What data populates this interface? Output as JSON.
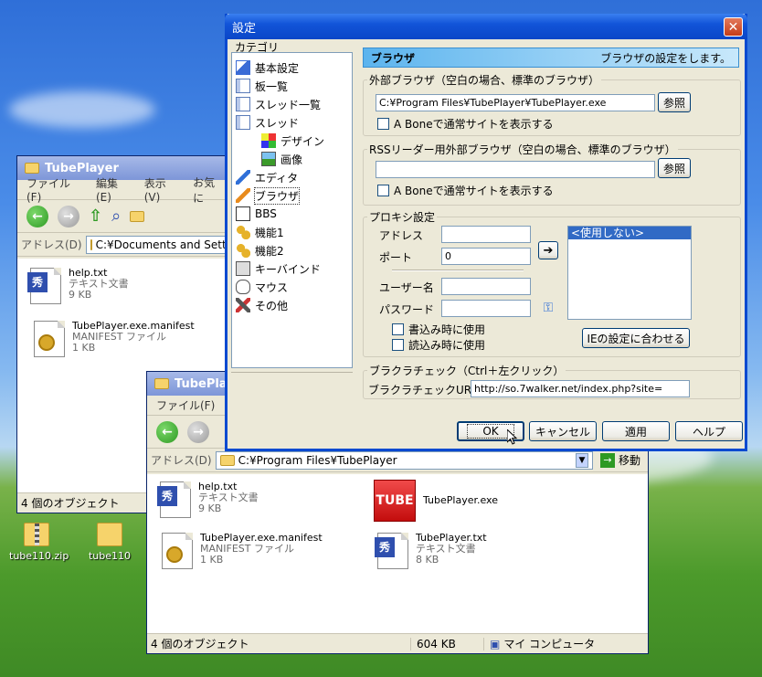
{
  "colors": {
    "xp_blue": "#0a4ad0",
    "selection": "#316ac5",
    "accent_header": "#5cb4ee"
  },
  "explorer_back": {
    "title": "TubePlayer",
    "menu": [
      "ファイル(F)",
      "編集(E)",
      "表示(V)",
      "お気に"
    ],
    "address_label": "アドレス(D)",
    "address": "C:¥Documents and Settin",
    "files": [
      {
        "name": "help.txt",
        "type": "テキスト文書",
        "size": "9 KB",
        "icon": "text-doc-icon"
      },
      {
        "name": "TubePlayer.exe.manifest",
        "type": "MANIFEST ファイル",
        "size": "1 KB",
        "icon": "manifest-icon"
      }
    ],
    "status": "4 個のオブジェクト"
  },
  "explorer_front": {
    "title": "TubePla",
    "menu": [
      "ファイル(F)"
    ],
    "address_label": "アドレス(D)",
    "address": "C:¥Program Files¥TubePlayer",
    "go_label": "移動",
    "files": [
      {
        "name": "help.txt",
        "type": "テキスト文書",
        "size": "9 KB",
        "icon": "text-doc-icon"
      },
      {
        "name": "TubePlayer.exe",
        "type": "",
        "size": "",
        "icon": "tube-exe-icon",
        "icon_text": "TUBE"
      },
      {
        "name": "TubePlayer.exe.manifest",
        "type": "MANIFEST ファイル",
        "size": "1 KB",
        "icon": "manifest-icon"
      },
      {
        "name": "TubePlayer.txt",
        "type": "テキスト文書",
        "size": "8 KB",
        "icon": "text-doc-icon"
      }
    ],
    "status": "4 個のオブジェクト",
    "status_size": "604 KB",
    "status_location": "マイ コンピュータ"
  },
  "desktop": {
    "icons": [
      {
        "label": "tube110.zip",
        "icon": "zip-folder-icon"
      },
      {
        "label": "tube110",
        "icon": "folder-icon"
      }
    ]
  },
  "dialog": {
    "title": "設定",
    "category_label": "カテゴリ",
    "tree": [
      {
        "label": "基本設定",
        "icon": "chart-icon",
        "indent": 0
      },
      {
        "label": "板一覧",
        "icon": "window-icon",
        "indent": 0
      },
      {
        "label": "スレッド一覧",
        "icon": "window-icon",
        "indent": 0
      },
      {
        "label": "スレッド",
        "icon": "window-icon",
        "indent": 0
      },
      {
        "label": "デザイン",
        "icon": "palette-icon",
        "indent": 1
      },
      {
        "label": "画像",
        "icon": "image-icon",
        "indent": 1
      },
      {
        "label": "エディタ",
        "icon": "pencil-icon",
        "indent": 0
      },
      {
        "label": "ブラウザ",
        "icon": "pen-icon",
        "indent": 0,
        "selected": true
      },
      {
        "label": "BBS",
        "icon": "board-icon",
        "indent": 0
      },
      {
        "label": "機能1",
        "icon": "gears-icon",
        "indent": 0
      },
      {
        "label": "機能2",
        "icon": "gears-icon",
        "indent": 0
      },
      {
        "label": "キーバインド",
        "icon": "key-icon",
        "indent": 0
      },
      {
        "label": "マウス",
        "icon": "mouse-icon",
        "indent": 0
      },
      {
        "label": "その他",
        "icon": "tools-icon",
        "indent": 0
      }
    ],
    "panel_title": "ブラウザ",
    "panel_desc": "ブラウザの設定をします。",
    "external_browser": {
      "legend": "外部ブラウザ（空白の場合、標準のブラウザ）",
      "path": "C:¥Program Files¥TubePlayer¥TubePlayer.exe",
      "browse": "参照",
      "checkbox": "A Boneで通常サイトを表示する"
    },
    "rss_browser": {
      "legend": "RSSリーダー用外部ブラウザ（空白の場合、標準のブラウザ）",
      "path": "",
      "browse": "参照",
      "checkbox": "A Boneで通常サイトを表示する"
    },
    "proxy": {
      "legend": "プロキシ設定",
      "address_label": "アドレス",
      "port_label": "ポート",
      "port_value": "0",
      "user_label": "ユーザー名",
      "password_label": "パスワード",
      "write_checkbox": "書込み時に使用",
      "read_checkbox": "読込み時に使用",
      "list_selected": "<使用しない>",
      "ie_button": "IEの設定に合わせる"
    },
    "browser_check": {
      "legend": "ブラクラチェック（Ctrl＋左クリック）",
      "url_label": "ブラクラチェックURL",
      "url": "http://so.7walker.net/index.php?site="
    },
    "buttons": {
      "ok": "OK",
      "cancel": "キャンセル",
      "apply": "適用",
      "help": "ヘルプ"
    }
  }
}
